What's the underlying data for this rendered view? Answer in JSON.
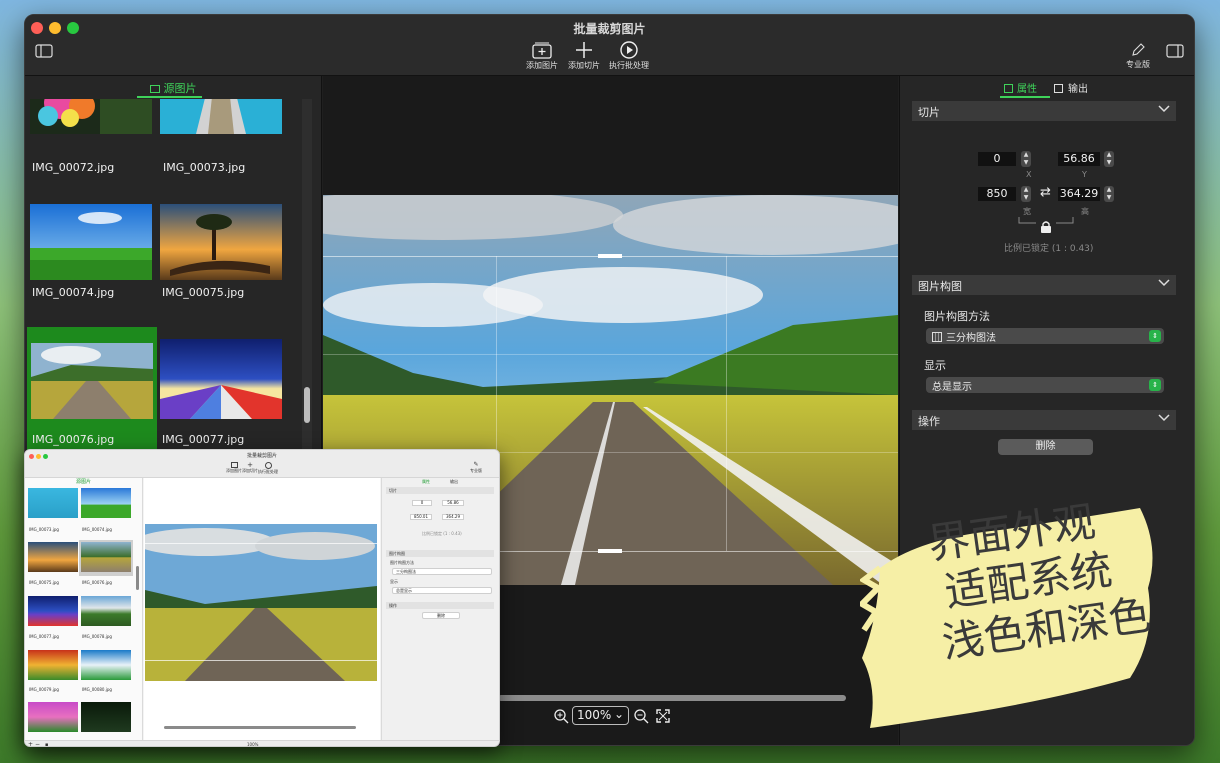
{
  "window": {
    "title": "批量裁剪图片"
  },
  "toolbar": {
    "add_image": "添加图片",
    "add_slice": "添加切片",
    "run_batch": "执行批处理",
    "pro": "专业版"
  },
  "left_panel": {
    "tab": "源图片",
    "thumbnails": [
      {
        "label": "",
        "selected": false
      },
      {
        "label": "",
        "selected": false
      },
      {
        "label": "IMG_00072.jpg",
        "selected": false
      },
      {
        "label": "IMG_00073.jpg",
        "selected": false
      },
      {
        "label": "IMG_00074.jpg",
        "selected": false
      },
      {
        "label": "IMG_00075.jpg",
        "selected": false
      },
      {
        "label": "IMG_00076.jpg",
        "selected": true
      },
      {
        "label": "IMG_00077.jpg",
        "selected": false
      }
    ]
  },
  "canvas": {
    "zoom": "100%"
  },
  "right_panel": {
    "tabs": {
      "properties": "属性",
      "output": "输出"
    },
    "slice": {
      "header": "切片",
      "x": "0",
      "y": "56.86",
      "w": "850",
      "h": "364.29",
      "x_label": "X",
      "y_label": "Y",
      "w_label": "宽",
      "h_label": "高",
      "ratio_text": "比例已锁定 (1 : 0.43)"
    },
    "composition": {
      "header": "图片构图",
      "method_label": "图片构图方法",
      "method_value": "三分构图法",
      "display_label": "显示",
      "display_value": "总是显示"
    },
    "operations": {
      "header": "操作",
      "delete": "删除"
    }
  },
  "mini": {
    "title": "批量裁剪图片",
    "toolbar": {
      "add_image": "添加图片",
      "add_slice": "添加切片",
      "run_batch": "执行批处理",
      "pro": "专业版"
    },
    "tab": "源图片",
    "tabs": {
      "properties": "属性",
      "output": "输出"
    },
    "thumbnails": [
      "IMG_00073.jpg",
      "IMG_00074.jpg",
      "IMG_00075.jpg",
      "IMG_00076.jpg",
      "IMG_00077.jpg",
      "IMG_00078.jpg",
      "IMG_00079.jpg",
      "IMG_00080.jpg"
    ],
    "slice_header": "切片",
    "x": "0",
    "y": "56.86",
    "w": "850.01",
    "h": "364.29",
    "ratio_text": "比例已锁定 (1 : 0.43)",
    "composition_header": "图片构图",
    "method_label": "图片构图方法",
    "method_value": "三分构图法",
    "display_label": "显示",
    "display_value": "总是显示",
    "operations_header": "操作",
    "delete": "删除",
    "zoom": "100%"
  },
  "note": {
    "line1": "界面外观",
    "line2": "适配系统",
    "line3": "浅色和深色"
  }
}
